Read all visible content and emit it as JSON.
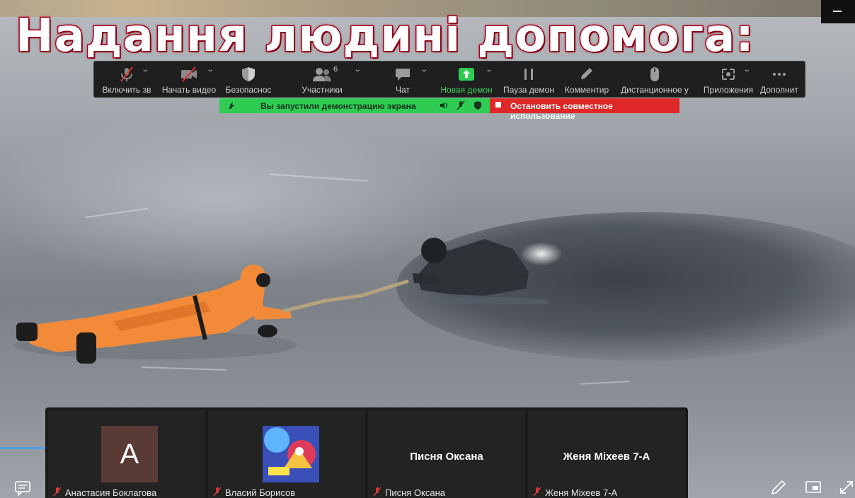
{
  "video": {
    "title_overlay": "Надання людині допомога:"
  },
  "toolbar": {
    "mic_label": "Включить зв",
    "video_label": "Начать видео",
    "security_label": "Безопаснос",
    "participants_label": "Участники",
    "participants_count": "6",
    "chat_label": "Чат",
    "new_share_label": "Новая демон",
    "pause_share_label": "Пауза демон",
    "annotate_label": "Комментир",
    "remote_control_label": "Дистанционное у",
    "apps_label": "Приложения",
    "more_label": "Дополнит"
  },
  "share_status": {
    "message": "Вы запустили демонстрацию экрана",
    "stop_label": "Остановить совместное использование"
  },
  "participants": [
    {
      "name": "Анастасия Боклагова",
      "avatar_letter": "A",
      "muted": true
    },
    {
      "name": "Власий Борисов",
      "avatar_kind": "image",
      "muted": true
    },
    {
      "name": "Писня Оксана",
      "display_name": "Писня Оксана",
      "muted": true
    },
    {
      "name": "Женя Міхеев 7-А",
      "display_name": "Женя Міхеев 7-А",
      "muted": true
    }
  ],
  "colors": {
    "toolbar_bg": "#1f1f1f",
    "share_green": "#2ecc52",
    "stop_red": "#e02828",
    "title_stroke": "#c0001e"
  },
  "icons": {
    "bottom_left": "chat-icon",
    "bottom_right": [
      "pencil-icon",
      "picture-in-picture-icon",
      "expand-icon"
    ]
  }
}
